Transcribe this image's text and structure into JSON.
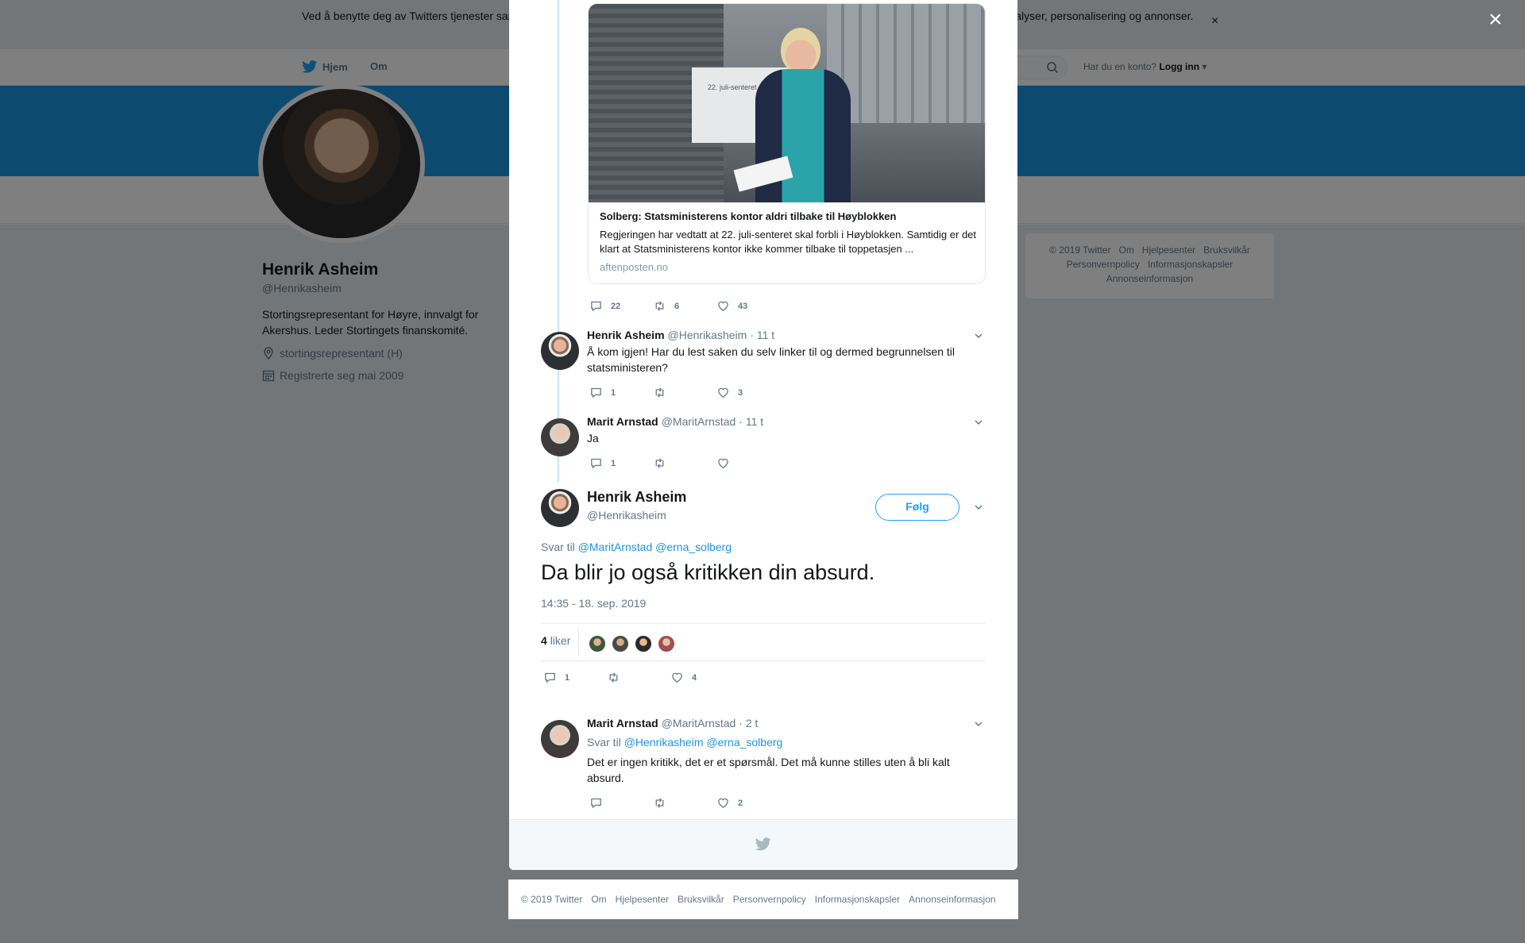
{
  "cookie_banner": {
    "text": "Ved å benytte deg av Twitters tjenester samtykker du i vår bruk av informasjonskapsler. Vi og våre partnere bruker informasjonskapsler til bl.a. analyser, personalisering og annonser.",
    "close": "×"
  },
  "topnav": {
    "home": "Hjem",
    "about": "Om",
    "login_prompt": "Har du en konto?",
    "login": "Logg inn"
  },
  "profile": {
    "name": "Henrik Asheim",
    "handle": "@Henrikasheim",
    "bio": "Stortingsrepresentant for Høyre, innvalgt for Akershus. Leder Stortingets finanskomité.",
    "location": "stortingsrepresentant (H)",
    "joined": "Registrerte seg mai 2009"
  },
  "side_footer": {
    "links": [
      "© 2019 Twitter",
      "Om",
      "Hjelpesenter",
      "Bruksvilkår",
      "Personvernpolicy",
      "Informasjonskapsler",
      "Annonseinformasjon"
    ]
  },
  "modal": {
    "close": "×",
    "link_card": {
      "sign_text": "22. juli-senteret",
      "title": "Solberg: Statsministerens kontor aldri tilbake til Høyblokken",
      "description": "Regjeringen har vedtatt at 22. juli-senteret skal forbli i Høyblokken. Samtidig er det klart at Statsministerens kontor ikke kommer tilbake til toppetasjen ...",
      "domain": "aftenposten.no"
    },
    "card_actions": {
      "replies": "22",
      "retweets": "6",
      "likes": "43"
    },
    "tweet1": {
      "name": "Henrik Asheim",
      "handle": "@Henrikasheim",
      "time": "· 11 t",
      "text": "Å kom igjen! Har du lest saken du selv linker til og dermed begrunnelsen til statsministeren?",
      "replies": "1",
      "retweets": "",
      "likes": "3"
    },
    "tweet2": {
      "name": "Marit Arnstad",
      "handle": "@MaritArnstad",
      "time": "· 11 t",
      "text": "Ja",
      "replies": "1",
      "retweets": "",
      "likes": ""
    },
    "main_tweet": {
      "name": "Henrik Asheim",
      "handle": "@Henrikasheim",
      "follow": "Følg",
      "reply_prefix": "Svar til",
      "reply_handles": "@MaritArnstad @erna_solberg",
      "text": "Da blir jo også kritikken din absurd.",
      "timestamp": "14:35 - 18. sep. 2019",
      "likes_count": "4",
      "likes_label": "liker",
      "replies": "1",
      "retweets": "",
      "likes": "4"
    },
    "tweet3": {
      "name": "Marit Arnstad",
      "handle": "@MaritArnstad",
      "time": "· 2 t",
      "reply_prefix": "Svar til",
      "reply_handles": "@Henrikasheim @erna_solberg",
      "text": "Det er ingen kritikk, det er et spørsmål. Det må kunne stilles uten å bli kalt absurd.",
      "replies": "",
      "retweets": "",
      "likes": "2"
    }
  },
  "bottom_footer": {
    "links": [
      "© 2019 Twitter",
      "Om",
      "Hjelpesenter",
      "Bruksvilkår",
      "Personvernpolicy",
      "Informasjonskapsler",
      "Annonseinformasjon"
    ]
  },
  "colors": {
    "brand_blue": "#1da1f2",
    "banner_blue": "#1b95e0",
    "background_gray": "#e6ecf0"
  }
}
